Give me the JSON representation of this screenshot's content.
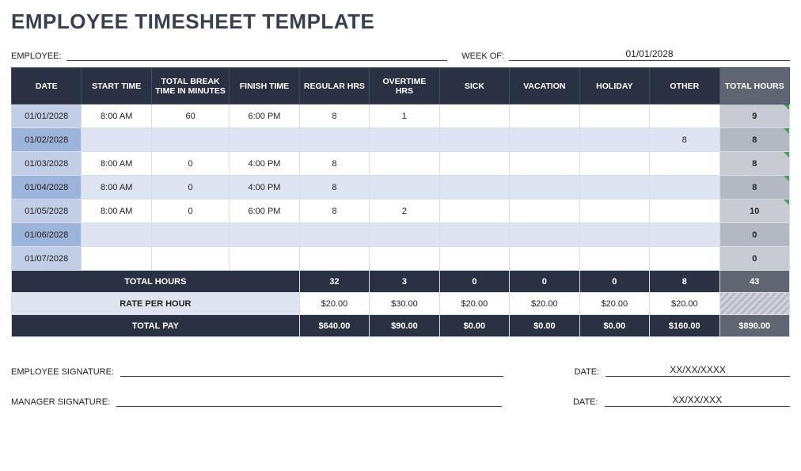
{
  "title": "EMPLOYEE TIMESHEET TEMPLATE",
  "labels": {
    "employee": "EMPLOYEE:",
    "week_of": "WEEK OF:",
    "emp_signature": "EMPLOYEE SIGNATURE:",
    "mgr_signature": "MANAGER SIGNATURE:",
    "date": "DATE:"
  },
  "employee_value": "",
  "week_of_value": "01/01/2028",
  "columns": {
    "date": "DATE",
    "start": "START TIME",
    "break": "TOTAL BREAK TIME IN MINUTES",
    "finish": "FINISH TIME",
    "regular": "REGULAR HRS",
    "overtime": "OVERTIME HRS",
    "sick": "SICK",
    "vacation": "VACATION",
    "holiday": "HOLIDAY",
    "other": "OTHER",
    "total_hours": "TOTAL HOURS"
  },
  "rows": [
    {
      "date": "01/01/2028",
      "start": "8:00 AM",
      "break": "60",
      "finish": "6:00 PM",
      "regular": "8",
      "overtime": "1",
      "sick": "",
      "vacation": "",
      "holiday": "",
      "other": "",
      "total": "9"
    },
    {
      "date": "01/02/2028",
      "start": "",
      "break": "",
      "finish": "",
      "regular": "",
      "overtime": "",
      "sick": "",
      "vacation": "",
      "holiday": "",
      "other": "8",
      "total": "8"
    },
    {
      "date": "01/03/2028",
      "start": "8:00 AM",
      "break": "0",
      "finish": "4:00 PM",
      "regular": "8",
      "overtime": "",
      "sick": "",
      "vacation": "",
      "holiday": "",
      "other": "",
      "total": "8"
    },
    {
      "date": "01/04/2028",
      "start": "8:00 AM",
      "break": "0",
      "finish": "4:00 PM",
      "regular": "8",
      "overtime": "",
      "sick": "",
      "vacation": "",
      "holiday": "",
      "other": "",
      "total": "8"
    },
    {
      "date": "01/05/2028",
      "start": "8:00 AM",
      "break": "0",
      "finish": "6:00 PM",
      "regular": "8",
      "overtime": "2",
      "sick": "",
      "vacation": "",
      "holiday": "",
      "other": "",
      "total": "10"
    },
    {
      "date": "01/06/2028",
      "start": "",
      "break": "",
      "finish": "",
      "regular": "",
      "overtime": "",
      "sick": "",
      "vacation": "",
      "holiday": "",
      "other": "",
      "total": "0"
    },
    {
      "date": "01/07/2028",
      "start": "",
      "break": "",
      "finish": "",
      "regular": "",
      "overtime": "",
      "sick": "",
      "vacation": "",
      "holiday": "",
      "other": "",
      "total": "0"
    }
  ],
  "summary": {
    "total_hours_label": "TOTAL HOURS",
    "rate_per_hour_label": "RATE PER HOUR",
    "total_pay_label": "TOTAL PAY",
    "hours": {
      "regular": "32",
      "overtime": "3",
      "sick": "0",
      "vacation": "0",
      "holiday": "0",
      "other": "8",
      "total": "43"
    },
    "rate": {
      "regular": "$20.00",
      "overtime": "$30.00",
      "sick": "$20.00",
      "vacation": "$20.00",
      "holiday": "$20.00",
      "other": "$20.00",
      "total": ""
    },
    "pay": {
      "regular": "$640.00",
      "overtime": "$90.00",
      "sick": "$0.00",
      "vacation": "$0.00",
      "holiday": "$0.00",
      "other": "$160.00",
      "total": "$890.00"
    }
  },
  "signatures": {
    "emp_date": "XX/XX/XXXX",
    "mgr_date": "XX/XX/XXX"
  }
}
